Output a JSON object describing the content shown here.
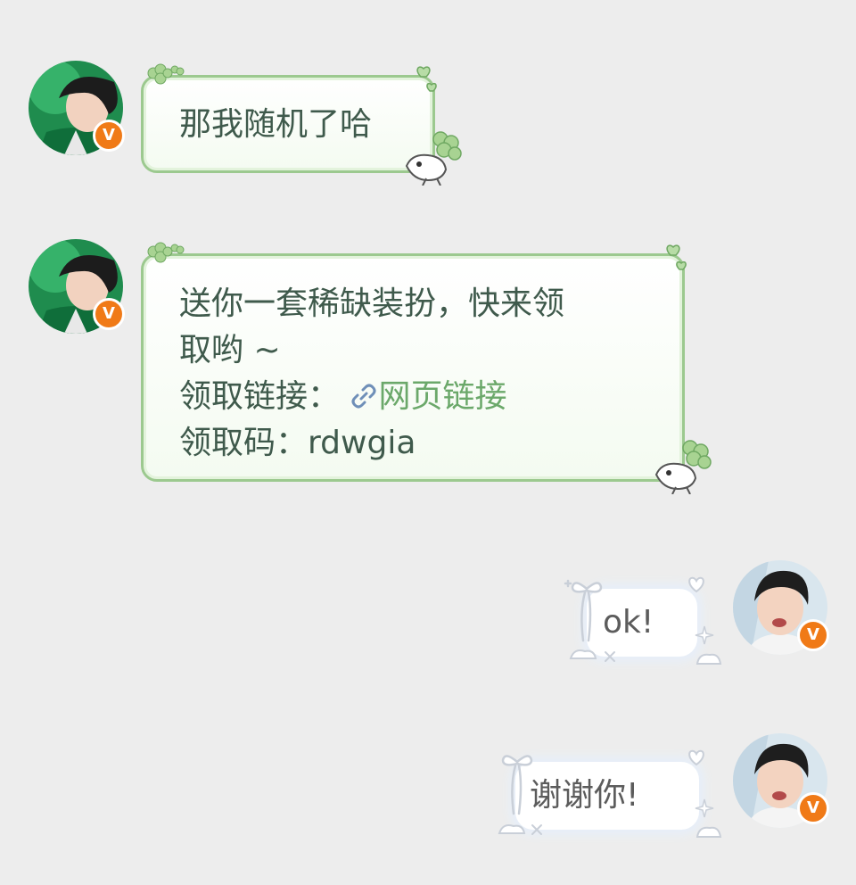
{
  "messages": [
    {
      "sender": "other",
      "text": "那我随机了哈"
    },
    {
      "sender": "other",
      "line1": "送你一套稀缺装扮，快来领",
      "line2": "取哟 ~",
      "link_label": "领取链接：",
      "link_text": "网页链接",
      "code_label": "领取码：",
      "code": "rdwgia"
    },
    {
      "sender": "me",
      "text": "ok!"
    },
    {
      "sender": "me",
      "text": "谢谢你!"
    }
  ],
  "badges": {
    "verified": "V"
  },
  "colors": {
    "background": "#ededed",
    "green_bubble_border": "#9cc98f",
    "green_text": "#3f5a4c",
    "link": "#6ba86a",
    "badge": "#f07a17"
  },
  "icons": [
    "avatar-other",
    "avatar-me",
    "verified-badge",
    "link-icon",
    "clover-icon",
    "bunny-sticker-icon",
    "bow-icon",
    "heart-icon",
    "sparkle-icon",
    "cloud-icon"
  ]
}
